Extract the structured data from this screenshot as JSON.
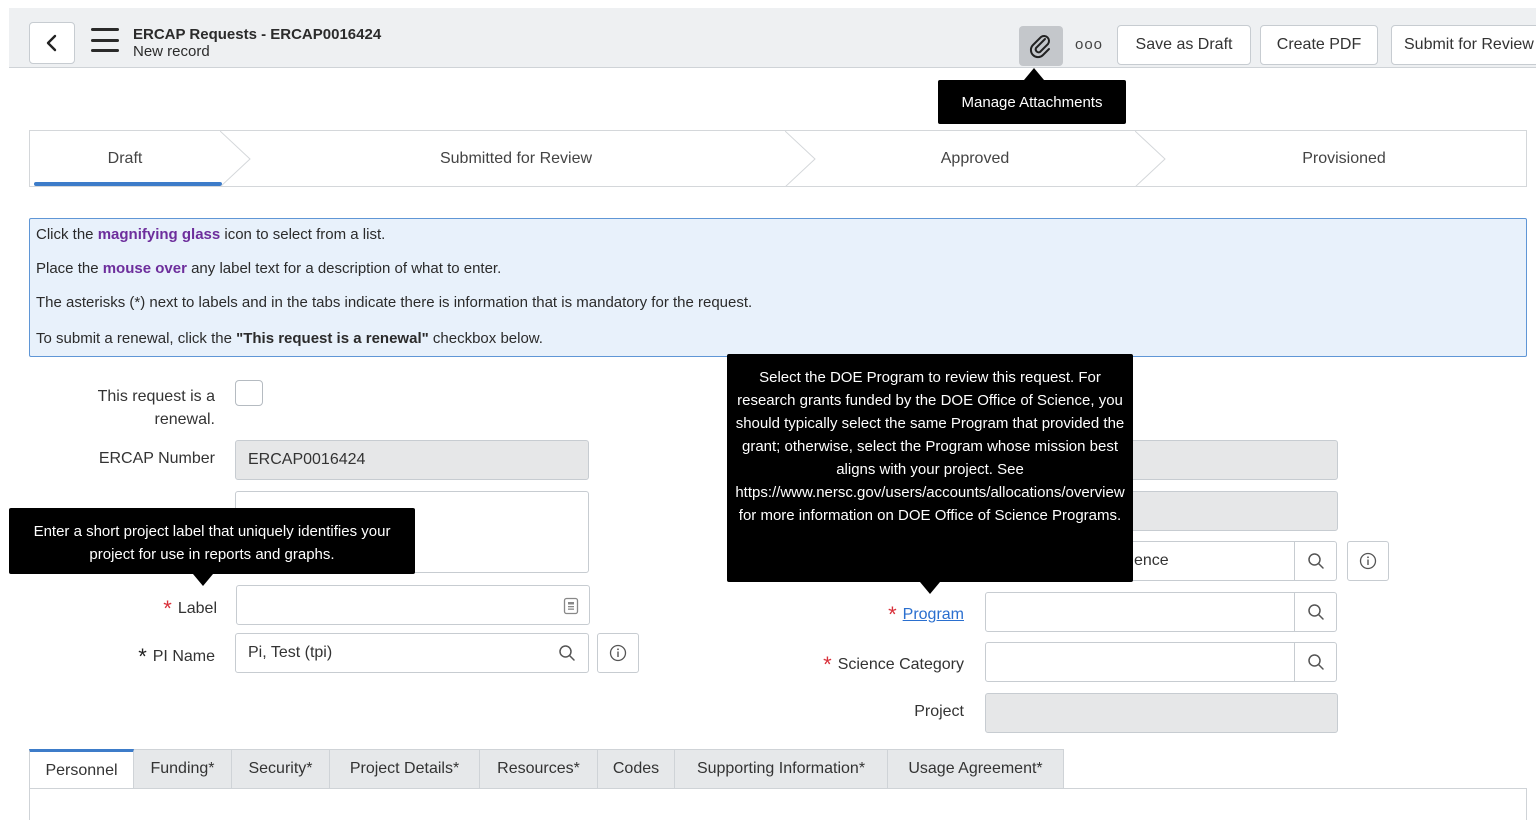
{
  "header": {
    "title": "ERCAP Requests - ERCAP0016424",
    "subtitle": "New record",
    "more_label": "ooo",
    "save_draft_label": "Save as Draft",
    "create_pdf_label": "Create PDF",
    "submit_label": "Submit for Review"
  },
  "tooltips": {
    "attachments": "Manage Attachments",
    "label_help": "Enter a short project label that uniquely identifies your project for use in reports and graphs.",
    "program_help_1": "Select the DOE Program to review this request. For research grants funded by the DOE Office of Science, you should typically select the same Program that provided the grant; otherwise, select the Program whose mission best aligns with your project. See",
    "program_help_url": "https://www.nersc.gov/users/accounts/allocations/overview",
    "program_help_2": "for more information on DOE Office of Science Programs."
  },
  "steps": [
    "Draft",
    "Submitted for Review",
    "Approved",
    "Provisioned"
  ],
  "info": {
    "line1_pre": "Click the ",
    "line1_hl": "magnifying glass",
    "line1_post": " icon to select from a list.",
    "line2_pre": "Place the ",
    "line2_hl": "mouse over",
    "line2_post": " any label text for a description of what to enter.",
    "line3": "The asterisks (*) next to labels and in the tabs indicate there is information that is mandatory for the request.",
    "line4_pre": "To submit a renewal, click the ",
    "line4_bold": "\"This request is a renewal\"",
    "line4_post": " checkbox below."
  },
  "form": {
    "renewal_label_1": "This request is a",
    "renewal_label_2": "renewal.",
    "ercap_number_label": "ERCAP Number",
    "ercap_number_value": "ERCAP0016424",
    "label_label": "Label",
    "pi_name_label": "PI Name",
    "pi_name_value": "Pi, Test (tpi)",
    "office_value_partial": "ence",
    "program_label": "Program",
    "science_category_label": "Science Category",
    "project_label": "Project",
    "required_marker": "*"
  },
  "tabs": [
    "Personnel",
    "Funding*",
    "Security*",
    "Project Details*",
    "Resources*",
    "Codes",
    "Supporting Information*",
    "Usage Agreement*"
  ],
  "colors": {
    "accent": "#3d7cc9",
    "required": "#d9303a",
    "highlight": "#6d2e9c",
    "info_bg": "#e8f1fb"
  }
}
